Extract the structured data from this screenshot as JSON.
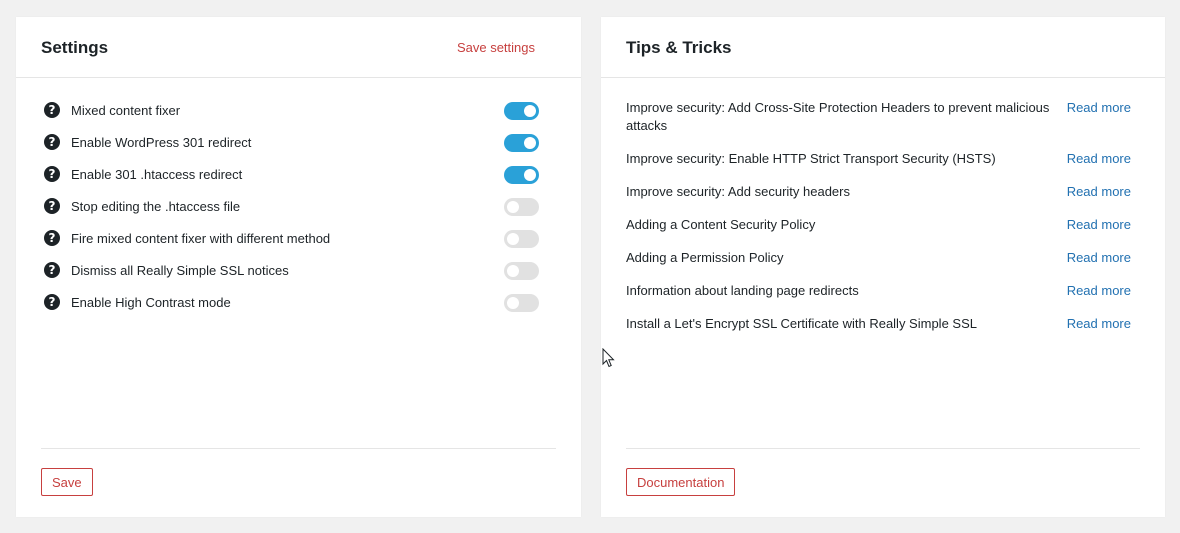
{
  "settings": {
    "title": "Settings",
    "save_settings_link": "Save settings",
    "save_button": "Save",
    "items": [
      {
        "label": "Mixed content fixer",
        "enabled": true
      },
      {
        "label": "Enable WordPress 301 redirect",
        "enabled": true
      },
      {
        "label": "Enable 301 .htaccess redirect",
        "enabled": true
      },
      {
        "label": "Stop editing the .htaccess file",
        "enabled": false
      },
      {
        "label": "Fire mixed content fixer with different method",
        "enabled": false
      },
      {
        "label": "Dismiss all Really Simple SSL notices",
        "enabled": false
      },
      {
        "label": "Enable High Contrast mode",
        "enabled": false
      }
    ]
  },
  "tips": {
    "title": "Tips & Tricks",
    "documentation_button": "Documentation",
    "items": [
      {
        "text": "Improve security: Add Cross-Site Protection Headers to prevent malicious attacks",
        "link": "Read more"
      },
      {
        "text": "Improve security: Enable HTTP Strict Transport Security (HSTS)",
        "link": "Read more"
      },
      {
        "text": "Improve security: Add security headers",
        "link": "Read more"
      },
      {
        "text": "Adding a Content Security Policy",
        "link": "Read more"
      },
      {
        "text": "Adding a Permission Policy",
        "link": "Read more"
      },
      {
        "text": "Information about landing page redirects",
        "link": "Read more"
      },
      {
        "text": "Install a Let's Encrypt SSL Certificate with Really Simple SSL",
        "link": "Read more"
      }
    ]
  },
  "icons": {
    "help": "question-mark-icon",
    "cursor": "mouse-pointer-icon"
  },
  "colors": {
    "accent_red": "#c7403f",
    "toggle_on": "#2aa1d8",
    "toggle_off": "#e1e1e1",
    "link_blue": "#2271b1"
  }
}
